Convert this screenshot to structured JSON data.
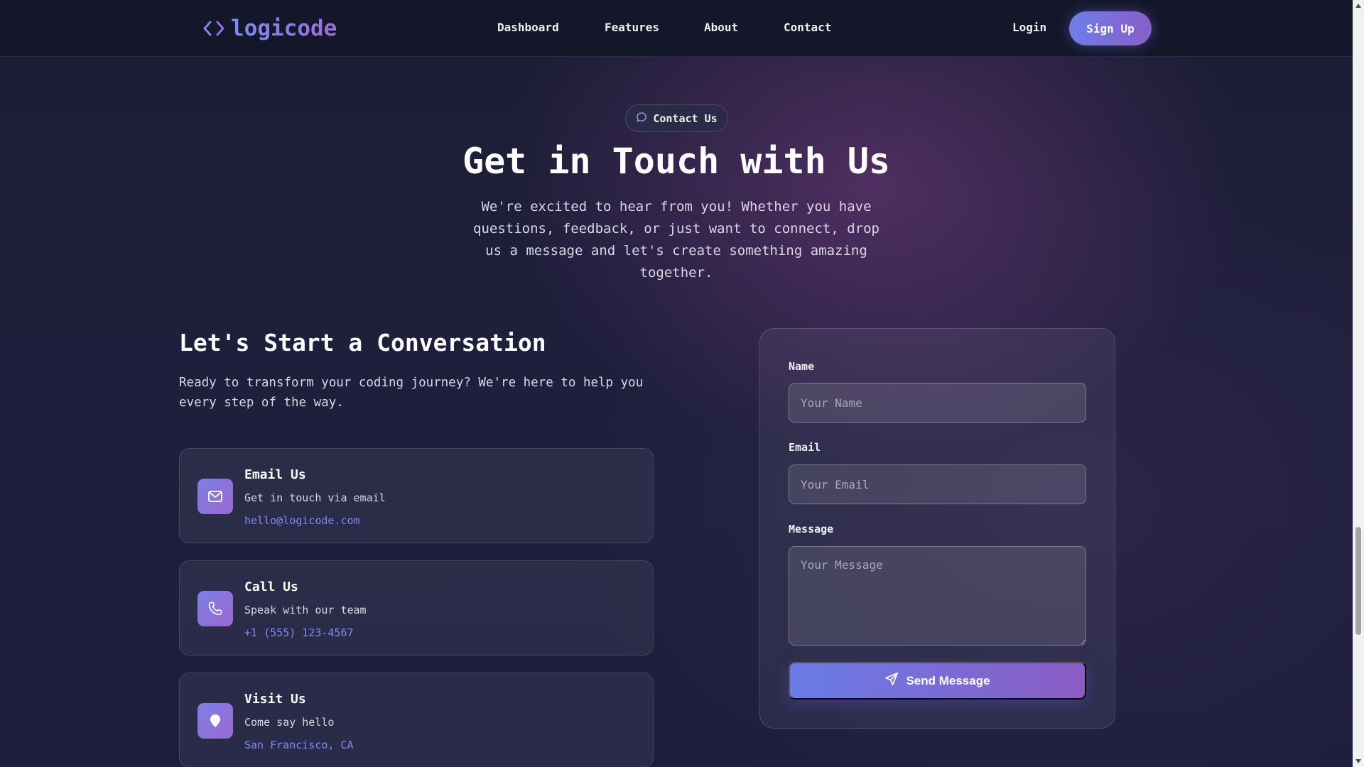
{
  "nav": {
    "logo_text": "logicode",
    "links": [
      "Dashboard",
      "Features",
      "About",
      "Contact"
    ],
    "login_label": "Login",
    "signup_label": "Sign Up"
  },
  "hero": {
    "badge_label": "Contact Us",
    "badge_icon": "chat-bubble-icon",
    "title": "Get in Touch with Us",
    "subtitle": "We're excited to hear from you! Whether you have questions, feedback, or just want to connect, drop us a message and let's create something amazing together."
  },
  "conversation": {
    "title": "Let's Start a Conversation",
    "subtitle": "Ready to transform your coding journey? We're here to help you every step of the way.",
    "cards": [
      {
        "title": "Email Us",
        "desc": "Get in touch via email",
        "link": "hello@logicode.com",
        "icon": "mail-icon"
      },
      {
        "title": "Call Us",
        "desc": "Speak with our team",
        "link": "+1 (555) 123-4567",
        "icon": "phone-icon"
      },
      {
        "title": "Visit Us",
        "desc": "Come say hello",
        "link": "San Francisco, CA",
        "icon": "map-pin-icon"
      }
    ]
  },
  "form": {
    "name_label": "Name",
    "name_placeholder": "Your Name",
    "email_label": "Email",
    "email_placeholder": "Your Email",
    "message_label": "Message",
    "message_placeholder": "Your Message",
    "submit_label": "Send Message",
    "submit_icon": "send-icon"
  },
  "colors": {
    "accent": "#7b8cf0",
    "accent_purple": "#8a5ec8",
    "nav_bg": "#14162a",
    "page_bg": "#1e1f3c"
  }
}
